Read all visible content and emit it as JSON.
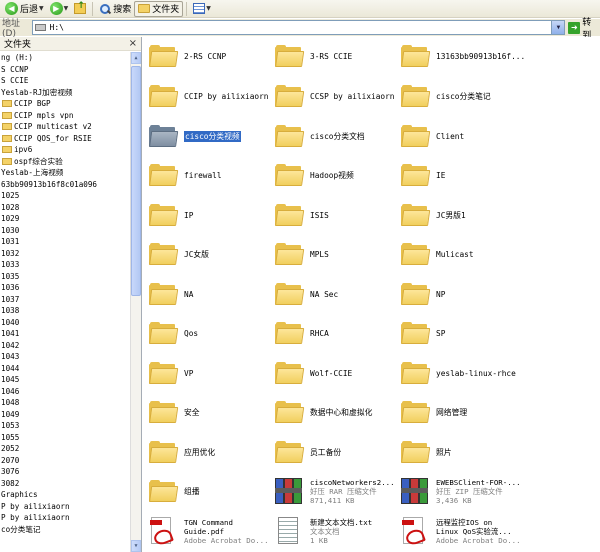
{
  "toolbar": {
    "back_label": "后退",
    "search_label": "搜索",
    "folders_label": "文件夹"
  },
  "address": {
    "label": "地址(D)",
    "value": "H:\\",
    "go_label": "转到"
  },
  "sidebar": {
    "title": "文件夹",
    "close": "×",
    "items": [
      {
        "label": "ng (H:)",
        "folder": false
      },
      {
        "label": "S CCNP",
        "folder": false
      },
      {
        "label": "S CCIE",
        "folder": false
      },
      {
        "label": "Yeslab-RJ加密视频",
        "folder": false
      },
      {
        "label": "CCIP BGP",
        "folder": true
      },
      {
        "label": "CCIP mpls vpn",
        "folder": true
      },
      {
        "label": "CCIP multicast v2",
        "folder": true
      },
      {
        "label": "CCIP QOS_for RSIE",
        "folder": true
      },
      {
        "label": "ipv6",
        "folder": true
      },
      {
        "label": "ospf综合实验",
        "folder": true
      },
      {
        "label": "Yeslab-上海视频",
        "folder": false
      },
      {
        "label": "63bb90913b16f8c01a096",
        "folder": false
      },
      {
        "label": "1025",
        "folder": false
      },
      {
        "label": "1028",
        "folder": false
      },
      {
        "label": "1029",
        "folder": false
      },
      {
        "label": "1030",
        "folder": false
      },
      {
        "label": "1031",
        "folder": false
      },
      {
        "label": "1032",
        "folder": false
      },
      {
        "label": "1033",
        "folder": false
      },
      {
        "label": "1035",
        "folder": false
      },
      {
        "label": "1036",
        "folder": false
      },
      {
        "label": "1037",
        "folder": false
      },
      {
        "label": "1038",
        "folder": false
      },
      {
        "label": "1040",
        "folder": false
      },
      {
        "label": "1041",
        "folder": false
      },
      {
        "label": "1042",
        "folder": false
      },
      {
        "label": "1043",
        "folder": false
      },
      {
        "label": "1044",
        "folder": false
      },
      {
        "label": "1045",
        "folder": false
      },
      {
        "label": "1046",
        "folder": false
      },
      {
        "label": "1048",
        "folder": false
      },
      {
        "label": "1049",
        "folder": false
      },
      {
        "label": "1053",
        "folder": false
      },
      {
        "label": "1055",
        "folder": false
      },
      {
        "label": "2052",
        "folder": false
      },
      {
        "label": "2070",
        "folder": false
      },
      {
        "label": "3076",
        "folder": false
      },
      {
        "label": "3082",
        "folder": false
      },
      {
        "label": "Graphics",
        "folder": false
      },
      {
        "label": "P by ailixiaorn",
        "folder": false
      },
      {
        "label": "P by ailixiaorn",
        "folder": false
      },
      {
        "label": "co分类笔记",
        "folder": false
      }
    ]
  },
  "content": {
    "folders": [
      {
        "label": "2-RS CCNP"
      },
      {
        "label": "3-RS CCIE"
      },
      {
        "label": "13163bb90913b16f..."
      },
      {
        "label": "CCIP by ailixiaorn"
      },
      {
        "label": "CCSP by ailixiaorn"
      },
      {
        "label": "cisco分类笔记"
      },
      {
        "label": "cisco分类视频",
        "selected": true
      },
      {
        "label": "cisco分类文档"
      },
      {
        "label": "Client"
      },
      {
        "label": "firewall"
      },
      {
        "label": "Hadoop视频"
      },
      {
        "label": "IE"
      },
      {
        "label": "IP"
      },
      {
        "label": "ISIS"
      },
      {
        "label": "JC男版1"
      },
      {
        "label": "JC女版"
      },
      {
        "label": "MPLS"
      },
      {
        "label": "Mulicast"
      },
      {
        "label": "NA"
      },
      {
        "label": "NA Sec"
      },
      {
        "label": "NP"
      },
      {
        "label": "Qos"
      },
      {
        "label": "RHCA"
      },
      {
        "label": "SP"
      },
      {
        "label": "VP"
      },
      {
        "label": "Wolf-CCIE"
      },
      {
        "label": "yeslab-linux-rhce"
      },
      {
        "label": "安全"
      },
      {
        "label": "数据中心和虚拟化"
      },
      {
        "label": "网络管理"
      },
      {
        "label": "应用优化"
      },
      {
        "label": "员工备份"
      },
      {
        "label": "照片"
      },
      {
        "label": "组播"
      }
    ],
    "files": [
      {
        "name": "ciscoNetworkers2...",
        "type": "好压 RAR 压缩文件",
        "size": "871,411 KB",
        "icon": "rar-icon"
      },
      {
        "name": "EWEBSClient-FOR-...",
        "type": "好压 ZIP 压缩文件",
        "size": "3,436 KB",
        "icon": "rar-icon"
      },
      {
        "name": "TGN Command",
        "name2": "Guide.pdf",
        "type": "Adobe Acrobat Do...",
        "icon": "pdf-icon"
      },
      {
        "name": "新建文本文档.txt",
        "type": "文本文档",
        "size": "1 KB",
        "icon": "txt-icon"
      },
      {
        "name": "远程监控IOS on",
        "name2": "Linux QoS实验流...",
        "type": "Adobe Acrobat Do...",
        "icon": "pdf-icon"
      }
    ]
  },
  "colors": {
    "selection": "#316ac5",
    "folder": "#f1cf5e",
    "toolbar": "#ece9d8"
  }
}
